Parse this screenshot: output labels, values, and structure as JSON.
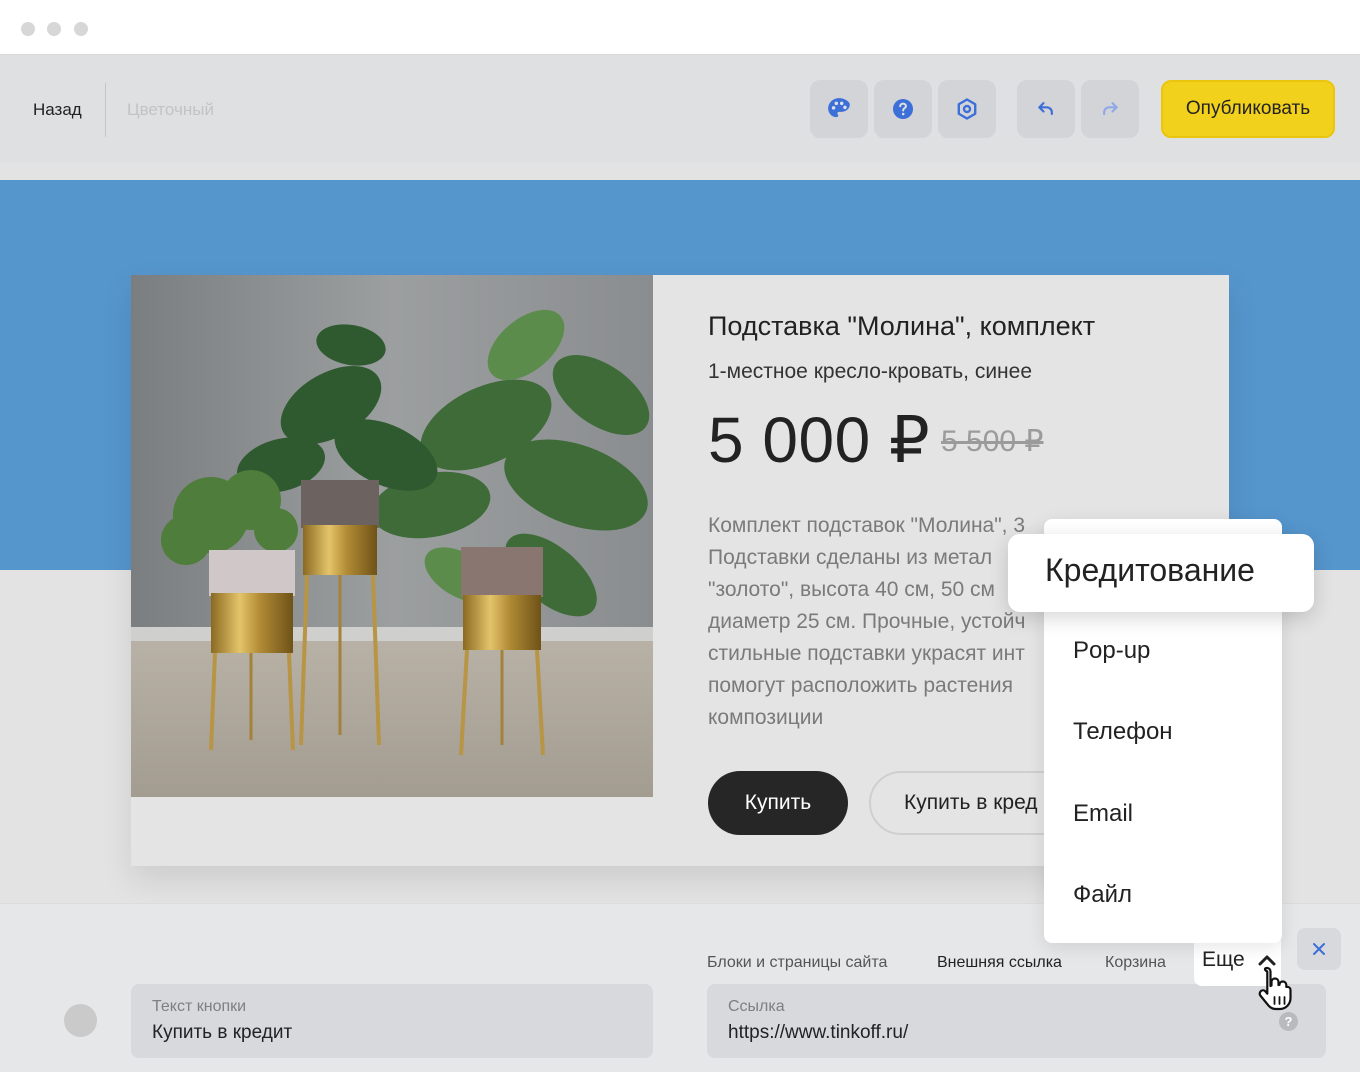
{
  "toolbar": {
    "back_label": "Назад",
    "project_name": "Цветочный",
    "icons": [
      "palette-icon",
      "question-icon",
      "settings-hexagon-icon",
      "undo-icon",
      "redo-icon"
    ],
    "publish_label": "Опубликовать"
  },
  "product": {
    "title": "Подставка \"Молина\", комплект",
    "subtitle": "1-местное кресло-кровать, синее",
    "price": "5 000 ₽",
    "old_price": "5 500 ₽",
    "description_lines": [
      "Комплект подставок \"Молина\", 3",
      "Подставки сделаны из метал",
      "\"золото\", высота 40 см, 50 см",
      "диаметр 25 см. Прочные, устойч",
      "стильные подставки украсят инт",
      "помогут расположить растения",
      "композиции"
    ],
    "buy_label": "Купить",
    "credit_label": "Купить в кред"
  },
  "menu": {
    "highlighted": "Кредитование",
    "items": [
      "Pop-up",
      "Телефон",
      "Email",
      "Файл"
    ]
  },
  "panel": {
    "tabs": [
      "Блоки и страницы сайта",
      "Внешняя ссылка",
      "Корзина"
    ],
    "more_label": "Еще",
    "button_text_label": "Текст кнопки",
    "button_text_value": "Купить в кредит",
    "link_label": "Ссылка",
    "link_value": "https://www.tinkoff.ru/",
    "help_glyph": "?"
  },
  "colors": {
    "accent_yellow": "#f2d11d",
    "band_blue": "#5596cd",
    "icon_blue": "#3d6fd8"
  }
}
